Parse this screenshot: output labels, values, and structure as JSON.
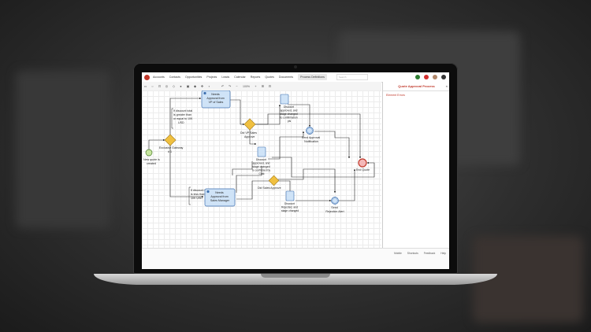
{
  "nav": {
    "items": [
      "Accounts",
      "Contacts",
      "Opportunities",
      "Projects",
      "Leads",
      "Calendar",
      "Reports",
      "Quotes",
      "Documents",
      "Process Definitions"
    ],
    "active": "Process Definitions",
    "search_placeholder": "Search"
  },
  "toolbar": {
    "zoom": "100%"
  },
  "panel": {
    "title": "Quote Approval Process",
    "close": "×",
    "errors_label": "Element Errors"
  },
  "footer": {
    "links": [
      "Mobile",
      "Shortcuts",
      "Feedback",
      "Help"
    ]
  },
  "diagram": {
    "start_label": [
      "New quote is",
      "created"
    ],
    "gateway1_label": [
      "Exclusive Gateway",
      "# 1"
    ],
    "note_top": [
      "If discount total",
      "is greater than",
      "or equal to 10K",
      "USD"
    ],
    "note_bottom": [
      "If discount total",
      "is less than",
      "10K USD"
    ],
    "task_vp": [
      "Needs",
      "Approval from",
      "VP of Sales"
    ],
    "task_sm": [
      "Needs",
      "Approval from",
      "Sales Manager"
    ],
    "gateway_vp": [
      "Did VP Sales",
      "Approve"
    ],
    "gateway_sm": [
      "Did Sales Approve"
    ],
    "doc_top": [
      "Discount",
      "approved, and",
      "stage changed",
      "to confirmation",
      "pls"
    ],
    "doc_mid": [
      "Discount",
      "approved, and",
      "stage changed",
      "to confirmed by",
      "Cust"
    ],
    "doc_bottom": [
      "Discount",
      "Rejected, and",
      "stage changed"
    ],
    "send_approval": [
      "Send Approval",
      "Notification"
    ],
    "send_rejection": [
      "Send",
      "Rejection Alert"
    ],
    "end_label": [
      "End Quote"
    ]
  }
}
